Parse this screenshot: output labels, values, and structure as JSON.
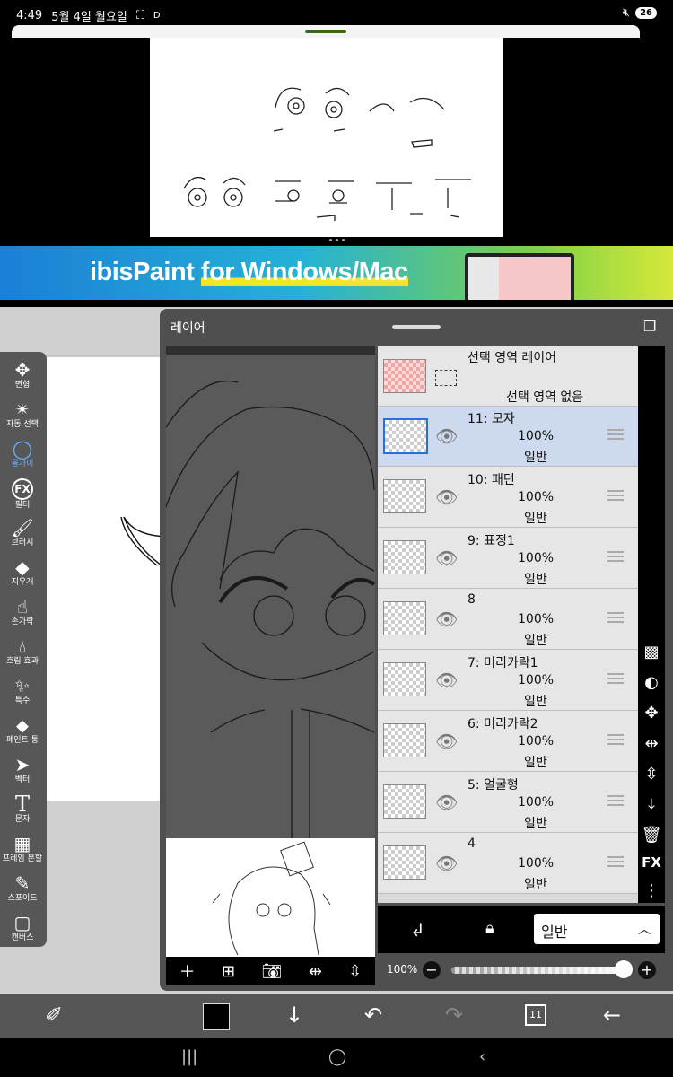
{
  "status_bar": {
    "time": "4:49",
    "date": "5월 4일 월요일",
    "indicator": "D",
    "battery": "26"
  },
  "banner": {
    "brand": "ibisPaint",
    "tagline": "for Windows/Mac"
  },
  "layer_panel": {
    "title": "레이어",
    "selection_layer": {
      "name": "선택 영역 레이어",
      "status": "선택 영역 없음"
    },
    "layers": [
      {
        "name": "11: 모자",
        "opacity": "100%",
        "mode": "일반",
        "selected": true
      },
      {
        "name": "10: 패턴",
        "opacity": "100%",
        "mode": "일반",
        "selected": false
      },
      {
        "name": "9: 표정1",
        "opacity": "100%",
        "mode": "일반",
        "selected": false
      },
      {
        "name": "8",
        "opacity": "100%",
        "mode": "일반",
        "selected": false
      },
      {
        "name": "7: 머리카락1",
        "opacity": "100%",
        "mode": "일반",
        "selected": false
      },
      {
        "name": "6: 머리카락2",
        "opacity": "100%",
        "mode": "일반",
        "selected": false
      },
      {
        "name": "5: 얼굴형",
        "opacity": "100%",
        "mode": "일반",
        "selected": false
      },
      {
        "name": "4",
        "opacity": "100%",
        "mode": "일반",
        "selected": false
      }
    ],
    "blend_mode": "일반",
    "opacity_label": "100%",
    "opacity_value": 1.0,
    "fx_label": "FX"
  },
  "tools": [
    {
      "label": "변형",
      "icon": "move-icon"
    },
    {
      "label": "자동 선택",
      "icon": "magic-wand-icon"
    },
    {
      "label": "올가미",
      "icon": "lasso-icon",
      "active": true
    },
    {
      "label": "필터",
      "icon": "fx-icon"
    },
    {
      "label": "브러시",
      "icon": "brush-icon"
    },
    {
      "label": "지우개",
      "icon": "eraser-icon"
    },
    {
      "label": "손가락",
      "icon": "finger-icon"
    },
    {
      "label": "흐림 효과",
      "icon": "blur-icon"
    },
    {
      "label": "특수",
      "icon": "special-icon"
    },
    {
      "label": "페인트 통",
      "icon": "paint-bucket-icon"
    },
    {
      "label": "벡터",
      "icon": "vector-icon"
    },
    {
      "label": "문자",
      "icon": "text-icon"
    },
    {
      "label": "프레임 분할",
      "icon": "frame-divider-icon"
    },
    {
      "label": "스포이드",
      "icon": "eyedropper-icon"
    },
    {
      "label": "캔버스",
      "icon": "canvas-icon"
    }
  ],
  "bottom_bar": {
    "layer_count": "11",
    "primary_color": "#000000"
  },
  "colors": {
    "selected_row": "#cdd9ee",
    "accent": "#2c6ed5",
    "active_tool": "#6fb0ff"
  }
}
